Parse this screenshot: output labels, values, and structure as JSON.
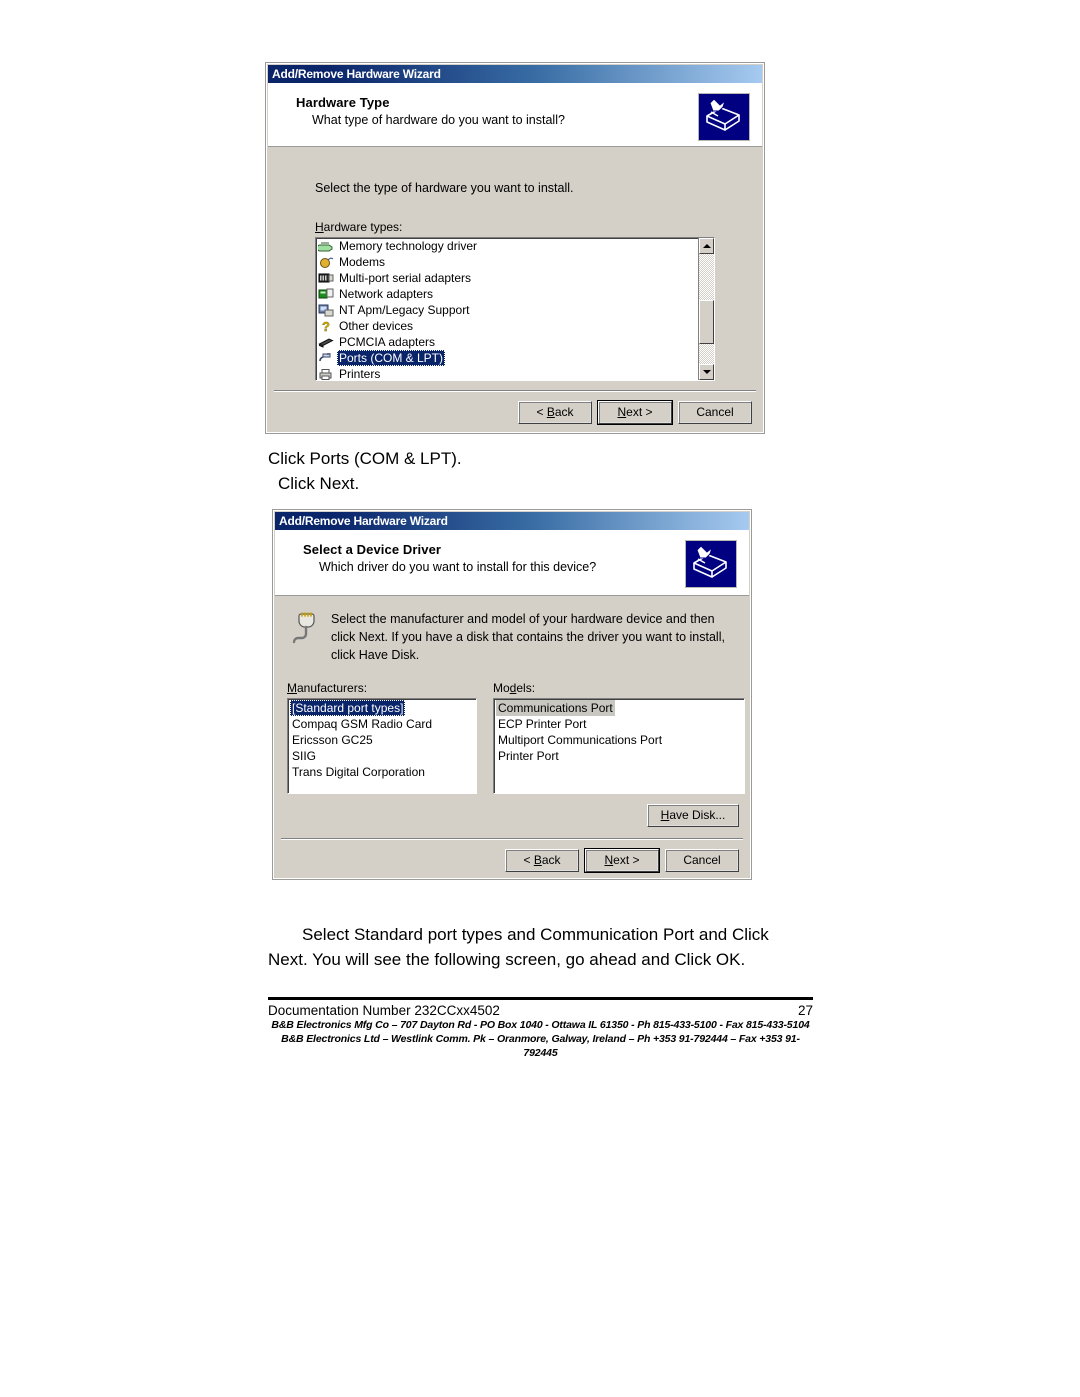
{
  "page": {
    "background": "#ffffff",
    "dialog_face": "#d4d0c8",
    "title_accent": "#0a246a",
    "selection_color": "#0a246a",
    "inactive_selection_color": "#c8c8c0"
  },
  "dialog1": {
    "title": "Add/Remove Hardware Wizard",
    "heading": "Hardware Type",
    "subheading": "What type of hardware do you want to install?",
    "icon": "add-hardware-wizard-icon",
    "instruction": "Select the type of hardware you want to install.",
    "list_label": "Hardware types:",
    "list_label_accesskey": "H",
    "items": [
      {
        "label": "Memory technology driver",
        "icon": "memory-chip-icon",
        "selected": false
      },
      {
        "label": "Modems",
        "icon": "modem-icon",
        "selected": false
      },
      {
        "label": "Multi-port serial adapters",
        "icon": "serial-adapter-icon",
        "selected": false
      },
      {
        "label": "Network adapters",
        "icon": "network-card-icon",
        "selected": false
      },
      {
        "label": "NT Apm/Legacy Support",
        "icon": "legacy-device-icon",
        "selected": false
      },
      {
        "label": "Other devices",
        "icon": "question-mark-icon",
        "selected": false
      },
      {
        "label": "PCMCIA adapters",
        "icon": "pcmcia-card-icon",
        "selected": false
      },
      {
        "label": "Ports (COM & LPT)",
        "icon": "port-connector-icon",
        "selected": true
      },
      {
        "label": "Printers",
        "icon": "printer-icon",
        "selected": false
      }
    ],
    "scrollbar": {
      "present": true,
      "up_arrow": "scroll-up-icon",
      "down_arrow": "scroll-down-icon"
    },
    "buttons": {
      "back": "< Back",
      "next": "Next >",
      "cancel": "Cancel",
      "default_button": "next"
    }
  },
  "caption1": {
    "line1": "Click Ports (COM & LPT).",
    "line2": "Click Next."
  },
  "dialog2": {
    "title": "Add/Remove Hardware Wizard",
    "heading": "Select a Device Driver",
    "subheading": "Which driver do you want to install for this device?",
    "icon": "add-hardware-wizard-icon",
    "info_icon": "plug-connector-icon",
    "info_text": "Select the manufacturer and model of your hardware device and then click Next. If you have a disk that contains the driver you want to install, click Have Disk.",
    "manufacturers_label": "Manufacturers:",
    "manufacturers_accesskey": "M",
    "manufacturers": [
      {
        "label": "[Standard port types]",
        "selected": true
      },
      {
        "label": "Compaq GSM Radio Card",
        "selected": false
      },
      {
        "label": "Ericsson GC25",
        "selected": false
      },
      {
        "label": "SIIG",
        "selected": false
      },
      {
        "label": "Trans Digital Corporation",
        "selected": false
      }
    ],
    "models_label": "Models:",
    "models_accesskey": "d",
    "models": [
      {
        "label": "Communications Port",
        "selected": true
      },
      {
        "label": "ECP Printer Port",
        "selected": false
      },
      {
        "label": "Multiport Communications Port",
        "selected": false
      },
      {
        "label": "Printer Port",
        "selected": false
      }
    ],
    "have_disk_button": "Have Disk...",
    "have_disk_accesskey": "H",
    "buttons": {
      "back": "< Back",
      "next": "Next >",
      "cancel": "Cancel",
      "default_button": "next"
    }
  },
  "caption2": {
    "line1": "Select Standard port types and Communication Port and Click",
    "line2": "Next. You will see the following screen, go ahead and Click OK."
  },
  "footer": {
    "doc_number": "Documentation Number 232CCxx4502",
    "page_number": "27",
    "address_line1": "B&B Electronics Mfg Co – 707 Dayton Rd - PO Box 1040 - Ottawa IL 61350 - Ph 815-433-5100 - Fax 815-433-5104",
    "address_line2": "B&B Electronics Ltd – Westlink Comm. Pk – Oranmore, Galway, Ireland – Ph +353 91-792444 – Fax +353 91-792445"
  }
}
